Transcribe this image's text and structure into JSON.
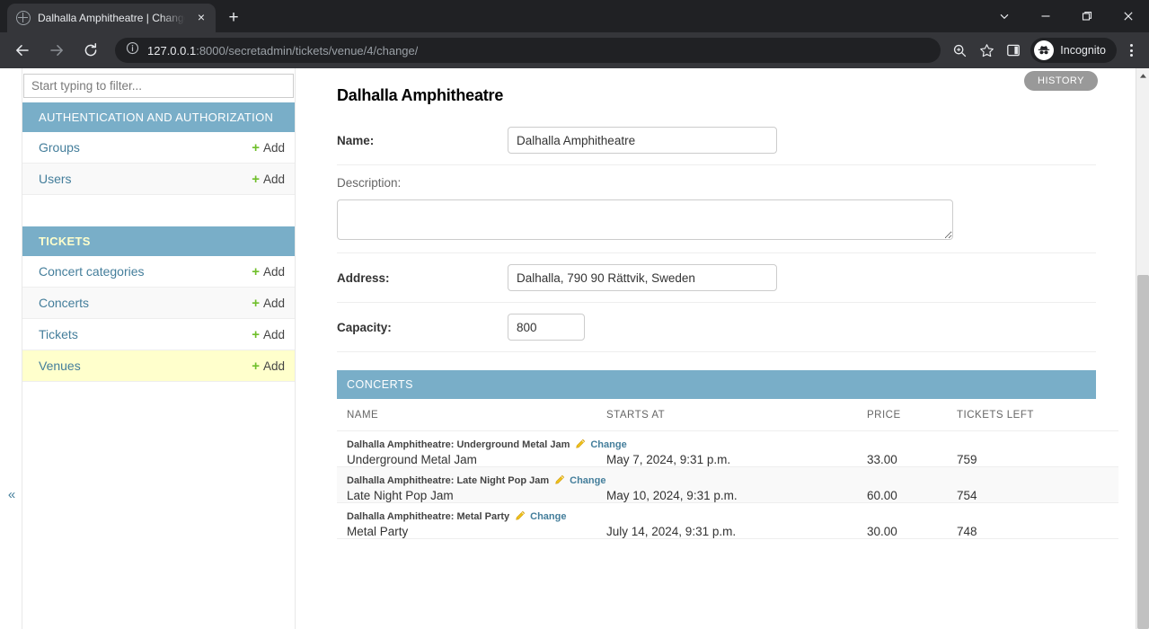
{
  "browser": {
    "tab": {
      "title": "Dalhalla Amphitheatre | Change v",
      "close_label": "×",
      "favicon": "django-globe-icon"
    },
    "new_tab_label": "+",
    "window_controls": {
      "tab_search": "chevron-down-icon",
      "minimize": "minimize-icon",
      "maximize": "restore-icon",
      "close": "close-icon"
    },
    "nav": {
      "back": "back-arrow-icon",
      "forward": "forward-arrow-icon",
      "reload": "reload-icon"
    },
    "omnibox": {
      "site_info_icon": "info-circle-icon",
      "host": "127.0.0.1",
      "path": ":8000/secretadmin/tickets/venue/4/change/",
      "full_url": "127.0.0.1:8000/secretadmin/tickets/venue/4/change/"
    },
    "toolbar_icons": {
      "zoom": "zoom-magnifier-icon",
      "bookmark": "star-icon",
      "side_panel": "side-panel-icon"
    },
    "profile": {
      "label": "Incognito",
      "icon": "incognito-hat-icon"
    },
    "menu": "kebab-menu-icon"
  },
  "sidebar": {
    "filter_placeholder": "Start typing to filter...",
    "filter_value": "",
    "toggle_label": "«",
    "apps": [
      {
        "caption": "AUTHENTICATION AND AUTHORIZATION",
        "current": false,
        "models": [
          {
            "name": "Groups",
            "add_label": "Add",
            "current": false
          },
          {
            "name": "Users",
            "add_label": "Add",
            "current": false
          }
        ]
      },
      {
        "caption": "TICKETS",
        "current": true,
        "models": [
          {
            "name": "Concert categories",
            "add_label": "Add",
            "current": false
          },
          {
            "name": "Concerts",
            "add_label": "Add",
            "current": false
          },
          {
            "name": "Tickets",
            "add_label": "Add",
            "current": false
          },
          {
            "name": "Venues",
            "add_label": "Add",
            "current": true
          }
        ]
      }
    ]
  },
  "main": {
    "history_label": "HISTORY",
    "page_title": "Dalhalla Amphitheatre",
    "form": {
      "name": {
        "label": "Name:",
        "value": "Dalhalla Amphitheatre"
      },
      "description": {
        "label": "Description:",
        "value": ""
      },
      "address": {
        "label": "Address:",
        "value": "Dalhalla, 790 90 Rättvik, Sweden"
      },
      "capacity": {
        "label": "Capacity:",
        "value": "800"
      }
    },
    "inline": {
      "heading": "CONCERTS",
      "columns": [
        "NAME",
        "STARTS AT",
        "PRICE",
        "TICKETS LEFT"
      ],
      "rows": [
        {
          "header": "Dalhalla Amphitheatre: Underground Metal Jam",
          "change_label": "Change",
          "name": "Underground Metal Jam",
          "starts_at": "May 7, 2024, 9:31 p.m.",
          "price": "33.00",
          "tickets_left": "759"
        },
        {
          "header": "Dalhalla Amphitheatre: Late Night Pop Jam",
          "change_label": "Change",
          "name": "Late Night Pop Jam",
          "starts_at": "May 10, 2024, 9:31 p.m.",
          "price": "60.00",
          "tickets_left": "754"
        },
        {
          "header": "Dalhalla Amphitheatre: Metal Party",
          "change_label": "Change",
          "name": "Metal Party",
          "starts_at": "July 14, 2024, 9:31 p.m.",
          "price": "30.00",
          "tickets_left": "748"
        }
      ]
    }
  },
  "colors": {
    "django_blue": "#79aec8",
    "link_blue": "#447e9b",
    "add_green": "#70bf2b",
    "current_yellow": "#ffffcc",
    "history_gray": "#999999"
  }
}
